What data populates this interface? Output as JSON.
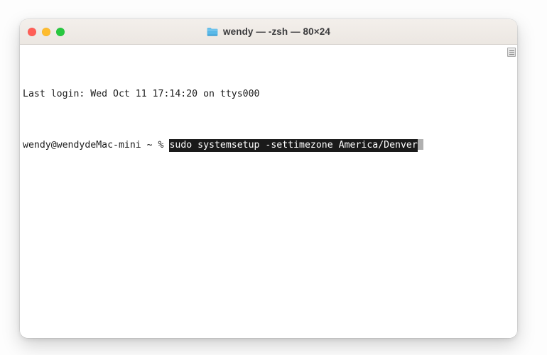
{
  "window": {
    "title": "wendy — -zsh — 80×24",
    "folder_icon": "folder-icon",
    "controls": {
      "close_label": "close",
      "minimize_label": "minimize",
      "maximize_label": "maximize",
      "close_color": "#ff5f57",
      "minimize_color": "#febc2e",
      "maximize_color": "#28c840"
    }
  },
  "terminal": {
    "background_color": "#ffffff",
    "foreground_color": "#1c1c1c",
    "highlight_background": "#1a1a1a",
    "highlight_foreground": "#ffffff",
    "cursor_color": "#b0b0b0",
    "lines": [
      {
        "id": "last-login",
        "text": "Last login: Wed Oct 11 17:14:20 on ttys000"
      },
      {
        "id": "prompt",
        "prompt": "wendy@wendydeMac-mini ~ % ",
        "command": "sudo systemsetup -settimezone America/Denver",
        "cursor": " "
      }
    ]
  },
  "scrollbar": {
    "thumb_label": "scrollbar-thumb"
  }
}
